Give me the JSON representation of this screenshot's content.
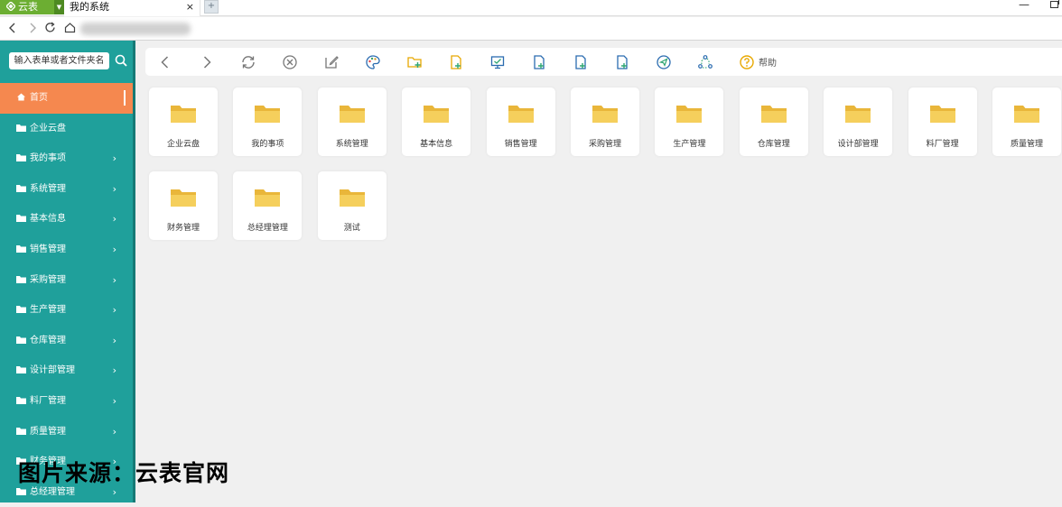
{
  "browser": {
    "app_tab_label": "云表",
    "page_tab_label": "我的系统",
    "page_tab_close": "×",
    "new_tab": "+",
    "win_min": "—"
  },
  "sidebar": {
    "search_placeholder": "输入表单或者文件夹名",
    "items": [
      {
        "label": "首页",
        "active": true,
        "chevron": false
      },
      {
        "label": "企业云盘",
        "active": false,
        "chevron": false
      },
      {
        "label": "我的事项",
        "active": false,
        "chevron": true
      },
      {
        "label": "系统管理",
        "active": false,
        "chevron": true
      },
      {
        "label": "基本信息",
        "active": false,
        "chevron": true
      },
      {
        "label": "销售管理",
        "active": false,
        "chevron": true
      },
      {
        "label": "采购管理",
        "active": false,
        "chevron": true
      },
      {
        "label": "生产管理",
        "active": false,
        "chevron": true
      },
      {
        "label": "仓库管理",
        "active": false,
        "chevron": true
      },
      {
        "label": "设计部管理",
        "active": false,
        "chevron": true
      },
      {
        "label": "料厂管理",
        "active": false,
        "chevron": true
      },
      {
        "label": "质量管理",
        "active": false,
        "chevron": true
      },
      {
        "label": "财务管理",
        "active": false,
        "chevron": true
      },
      {
        "label": "总经理管理",
        "active": false,
        "chevron": true
      }
    ],
    "chevron_glyph": "›"
  },
  "toolbar": {
    "help_label": "帮助",
    "icons": [
      "back-icon",
      "forward-icon",
      "refresh-icon",
      "close-circle-icon",
      "edit-icon",
      "palette-icon",
      "new-folder-icon",
      "new-file-icon",
      "monitor-icon",
      "file-add-icon",
      "file-add-2-icon",
      "file-add-3-icon",
      "send-icon",
      "share-icon",
      "help-icon"
    ]
  },
  "folders": [
    "企业云盘",
    "我的事项",
    "系统管理",
    "基本信息",
    "销售管理",
    "采购管理",
    "生产管理",
    "仓库管理",
    "设计部管理",
    "料厂管理",
    "质量管理",
    "财务管理",
    "总经理管理",
    "测试"
  ],
  "watermark": "图片来源：云表官网",
  "colors": {
    "sidebar": "#1fa09b",
    "active_item": "#f5884f",
    "app_tab": "#6cae32",
    "folder": "#f2c94c",
    "toolbar_icon_blue": "#2b6cb0",
    "toolbar_icon_gray": "#888888",
    "toolbar_icon_green": "#2ea572",
    "toolbar_icon_yellow": "#e8a800"
  }
}
